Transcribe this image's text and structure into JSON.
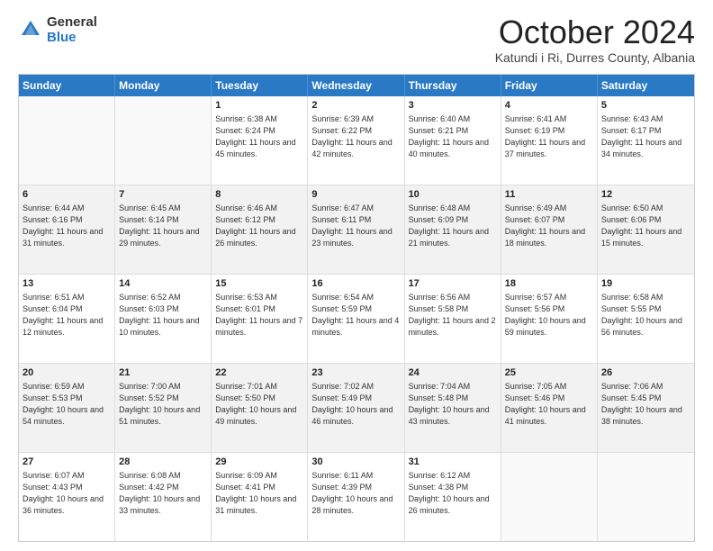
{
  "header": {
    "logo_general": "General",
    "logo_blue": "Blue",
    "month_title": "October 2024",
    "location": "Katundi i Ri, Durres County, Albania"
  },
  "days_of_week": [
    "Sunday",
    "Monday",
    "Tuesday",
    "Wednesday",
    "Thursday",
    "Friday",
    "Saturday"
  ],
  "weeks": [
    [
      {
        "day": "",
        "info": ""
      },
      {
        "day": "",
        "info": ""
      },
      {
        "day": "1",
        "info": "Sunrise: 6:38 AM\nSunset: 6:24 PM\nDaylight: 11 hours and 45 minutes."
      },
      {
        "day": "2",
        "info": "Sunrise: 6:39 AM\nSunset: 6:22 PM\nDaylight: 11 hours and 42 minutes."
      },
      {
        "day": "3",
        "info": "Sunrise: 6:40 AM\nSunset: 6:21 PM\nDaylight: 11 hours and 40 minutes."
      },
      {
        "day": "4",
        "info": "Sunrise: 6:41 AM\nSunset: 6:19 PM\nDaylight: 11 hours and 37 minutes."
      },
      {
        "day": "5",
        "info": "Sunrise: 6:43 AM\nSunset: 6:17 PM\nDaylight: 11 hours and 34 minutes."
      }
    ],
    [
      {
        "day": "6",
        "info": "Sunrise: 6:44 AM\nSunset: 6:16 PM\nDaylight: 11 hours and 31 minutes."
      },
      {
        "day": "7",
        "info": "Sunrise: 6:45 AM\nSunset: 6:14 PM\nDaylight: 11 hours and 29 minutes."
      },
      {
        "day": "8",
        "info": "Sunrise: 6:46 AM\nSunset: 6:12 PM\nDaylight: 11 hours and 26 minutes."
      },
      {
        "day": "9",
        "info": "Sunrise: 6:47 AM\nSunset: 6:11 PM\nDaylight: 11 hours and 23 minutes."
      },
      {
        "day": "10",
        "info": "Sunrise: 6:48 AM\nSunset: 6:09 PM\nDaylight: 11 hours and 21 minutes."
      },
      {
        "day": "11",
        "info": "Sunrise: 6:49 AM\nSunset: 6:07 PM\nDaylight: 11 hours and 18 minutes."
      },
      {
        "day": "12",
        "info": "Sunrise: 6:50 AM\nSunset: 6:06 PM\nDaylight: 11 hours and 15 minutes."
      }
    ],
    [
      {
        "day": "13",
        "info": "Sunrise: 6:51 AM\nSunset: 6:04 PM\nDaylight: 11 hours and 12 minutes."
      },
      {
        "day": "14",
        "info": "Sunrise: 6:52 AM\nSunset: 6:03 PM\nDaylight: 11 hours and 10 minutes."
      },
      {
        "day": "15",
        "info": "Sunrise: 6:53 AM\nSunset: 6:01 PM\nDaylight: 11 hours and 7 minutes."
      },
      {
        "day": "16",
        "info": "Sunrise: 6:54 AM\nSunset: 5:59 PM\nDaylight: 11 hours and 4 minutes."
      },
      {
        "day": "17",
        "info": "Sunrise: 6:56 AM\nSunset: 5:58 PM\nDaylight: 11 hours and 2 minutes."
      },
      {
        "day": "18",
        "info": "Sunrise: 6:57 AM\nSunset: 5:56 PM\nDaylight: 10 hours and 59 minutes."
      },
      {
        "day": "19",
        "info": "Sunrise: 6:58 AM\nSunset: 5:55 PM\nDaylight: 10 hours and 56 minutes."
      }
    ],
    [
      {
        "day": "20",
        "info": "Sunrise: 6:59 AM\nSunset: 5:53 PM\nDaylight: 10 hours and 54 minutes."
      },
      {
        "day": "21",
        "info": "Sunrise: 7:00 AM\nSunset: 5:52 PM\nDaylight: 10 hours and 51 minutes."
      },
      {
        "day": "22",
        "info": "Sunrise: 7:01 AM\nSunset: 5:50 PM\nDaylight: 10 hours and 49 minutes."
      },
      {
        "day": "23",
        "info": "Sunrise: 7:02 AM\nSunset: 5:49 PM\nDaylight: 10 hours and 46 minutes."
      },
      {
        "day": "24",
        "info": "Sunrise: 7:04 AM\nSunset: 5:48 PM\nDaylight: 10 hours and 43 minutes."
      },
      {
        "day": "25",
        "info": "Sunrise: 7:05 AM\nSunset: 5:46 PM\nDaylight: 10 hours and 41 minutes."
      },
      {
        "day": "26",
        "info": "Sunrise: 7:06 AM\nSunset: 5:45 PM\nDaylight: 10 hours and 38 minutes."
      }
    ],
    [
      {
        "day": "27",
        "info": "Sunrise: 6:07 AM\nSunset: 4:43 PM\nDaylight: 10 hours and 36 minutes."
      },
      {
        "day": "28",
        "info": "Sunrise: 6:08 AM\nSunset: 4:42 PM\nDaylight: 10 hours and 33 minutes."
      },
      {
        "day": "29",
        "info": "Sunrise: 6:09 AM\nSunset: 4:41 PM\nDaylight: 10 hours and 31 minutes."
      },
      {
        "day": "30",
        "info": "Sunrise: 6:11 AM\nSunset: 4:39 PM\nDaylight: 10 hours and 28 minutes."
      },
      {
        "day": "31",
        "info": "Sunrise: 6:12 AM\nSunset: 4:38 PM\nDaylight: 10 hours and 26 minutes."
      },
      {
        "day": "",
        "info": ""
      },
      {
        "day": "",
        "info": ""
      }
    ]
  ],
  "shaded_rows": [
    1,
    3
  ]
}
